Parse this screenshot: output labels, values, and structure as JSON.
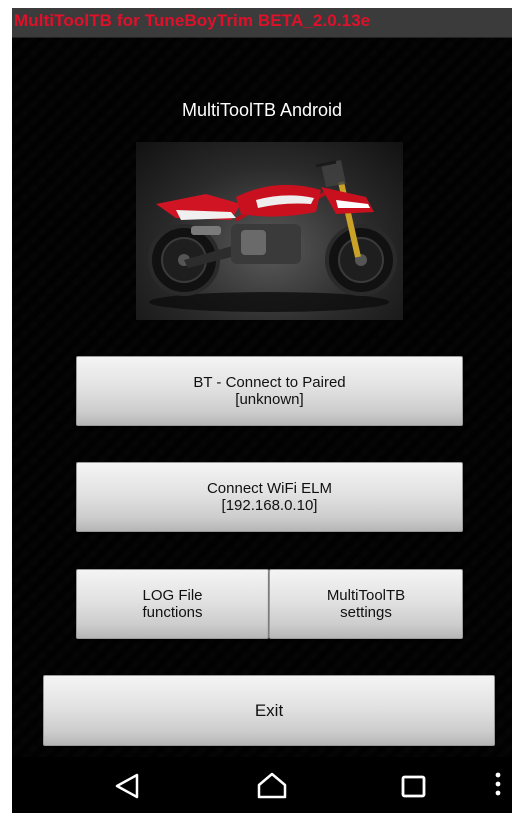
{
  "titlebar": {
    "title": "MultiToolTB for TuneBoyTrim BETA_2.0.13e",
    "title_color": "#e0102a"
  },
  "main": {
    "heading": "MultiToolTB Android",
    "photo_icon": "motorcycle-image",
    "buttons": {
      "bt_line1": "BT - Connect to Paired",
      "bt_line2": "[unknown]",
      "wifi_line1": "Connect WiFi ELM",
      "wifi_line2": "[192.168.0.10]",
      "log_line1": "LOG File",
      "log_line2": "functions",
      "settings_line1": "MultiToolTB",
      "settings_line2": "settings",
      "exit": "Exit"
    }
  },
  "navbar": {
    "back_icon": "back-icon",
    "home_icon": "home-icon",
    "recents_icon": "recents-icon",
    "menu_icon": "overflow-menu-icon"
  }
}
